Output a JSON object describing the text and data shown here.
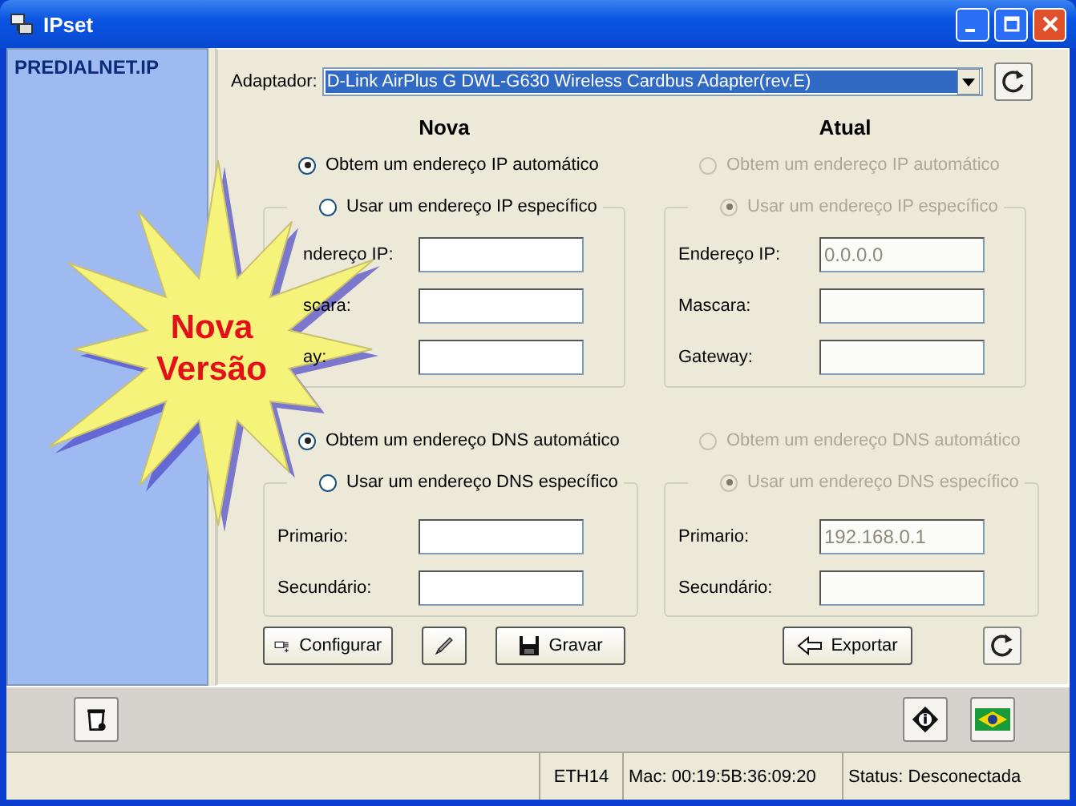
{
  "window": {
    "title": "IPset"
  },
  "sidebar": {
    "title": "PREDIALNET.IP"
  },
  "adapter": {
    "label": "Adaptador:",
    "value": "D-Link AirPlus G DWL-G630 Wireless Cardbus Adapter(rev.E)"
  },
  "columns": [
    {
      "heading": "Nova",
      "disabled": false,
      "ip_modes": [
        {
          "label": "Obtem um endereço IP automático",
          "selected": true
        },
        {
          "label": "Usar um endereço IP específico",
          "selected": false
        }
      ],
      "ip_fields": [
        {
          "label": "ndereço IP:"
        },
        {
          "label": "scara:"
        },
        {
          "label": "ay:"
        }
      ],
      "dns_modes": [
        {
          "label": "Obtem um endereço DNS automático",
          "selected": true
        },
        {
          "label": "Usar um endereço DNS específico",
          "selected": false
        }
      ],
      "dns_fields": [
        {
          "label": "Primario:"
        },
        {
          "label": "Secundário:"
        }
      ],
      "buttons": [
        {
          "kind": "configure",
          "label": "Configurar"
        },
        {
          "kind": "pencil"
        },
        {
          "kind": "save",
          "label": "Gravar"
        }
      ]
    },
    {
      "heading": "Atual",
      "disabled": true,
      "ip_modes": [
        {
          "label": "Obtem um endereço IP automático",
          "selected": false
        },
        {
          "label": "Usar um endereço IP específico",
          "selected": true
        }
      ],
      "ip_fields": [
        {
          "label": "Endereço IP:",
          "value": "0.0.0.0"
        },
        {
          "label": "Mascara:"
        },
        {
          "label": "Gateway:"
        }
      ],
      "dns_modes": [
        {
          "label": "Obtem um endereço DNS automático",
          "selected": false
        },
        {
          "label": "Usar um endereço DNS específico",
          "selected": true
        }
      ],
      "dns_fields": [
        {
          "label": "Primario:",
          "value": "192.168.0.1"
        },
        {
          "label": "Secundário:"
        }
      ],
      "buttons": [
        {
          "kind": "export",
          "label": "Exportar"
        },
        {
          "kind": "refresh"
        }
      ]
    }
  ],
  "badge": {
    "text": "Nova Versão"
  },
  "status_bar": [
    "ETH14",
    "Mac: 00:19:5B:36:09:20",
    "Status: Desconectada"
  ]
}
